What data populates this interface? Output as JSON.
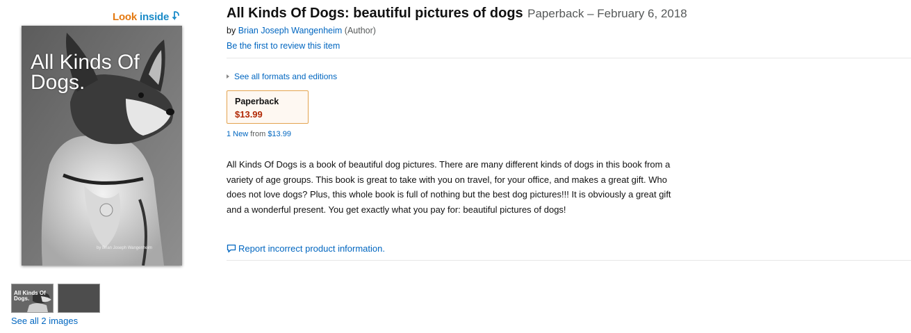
{
  "look_inside": {
    "word1": "Look",
    "word2": "inside",
    "icon": "down-arrow-icon"
  },
  "cover": {
    "title": "All Kinds Of Dogs.",
    "author": "by Brian Joseph Wangenheim"
  },
  "thumbnails": {
    "items": [
      {
        "title": "All Kinds Of Dogs."
      },
      {
        "title": ""
      }
    ],
    "see_all_label": "See all 2 images"
  },
  "product": {
    "title": "All Kinds Of Dogs: beautiful pictures of dogs",
    "format_date": "Paperback – February 6, 2018",
    "by_label": "by",
    "author_name": "Brian Joseph Wangenheim",
    "author_role": "(Author)",
    "review_link": "Be the first to review this item"
  },
  "formats": {
    "see_all_label": "See all formats and editions",
    "selected": {
      "name": "Paperback",
      "price": "$13.99"
    },
    "offers_new": "1 New",
    "offers_from": "from",
    "offers_price": "$13.99"
  },
  "description": "All Kinds Of Dogs is a book of beautiful dog pictures. There are many different kinds of dogs in this book from a variety of age groups. This book is great to take with you on travel, for your office, and makes a great gift. Who does not love dogs? Plus, this whole book is full of nothing but the best dog pictures!!! It is obviously a great gift and a wonderful present. You get exactly what you pay for: beautiful pictures of dogs!",
  "report": {
    "label": "Report incorrect product information.",
    "icon": "speech-bubble-icon"
  },
  "colors": {
    "link": "#0066c0",
    "price": "#b12704",
    "look_orange": "#e47911",
    "look_blue": "#1a8bc8",
    "selected_border": "#e3a34f"
  }
}
